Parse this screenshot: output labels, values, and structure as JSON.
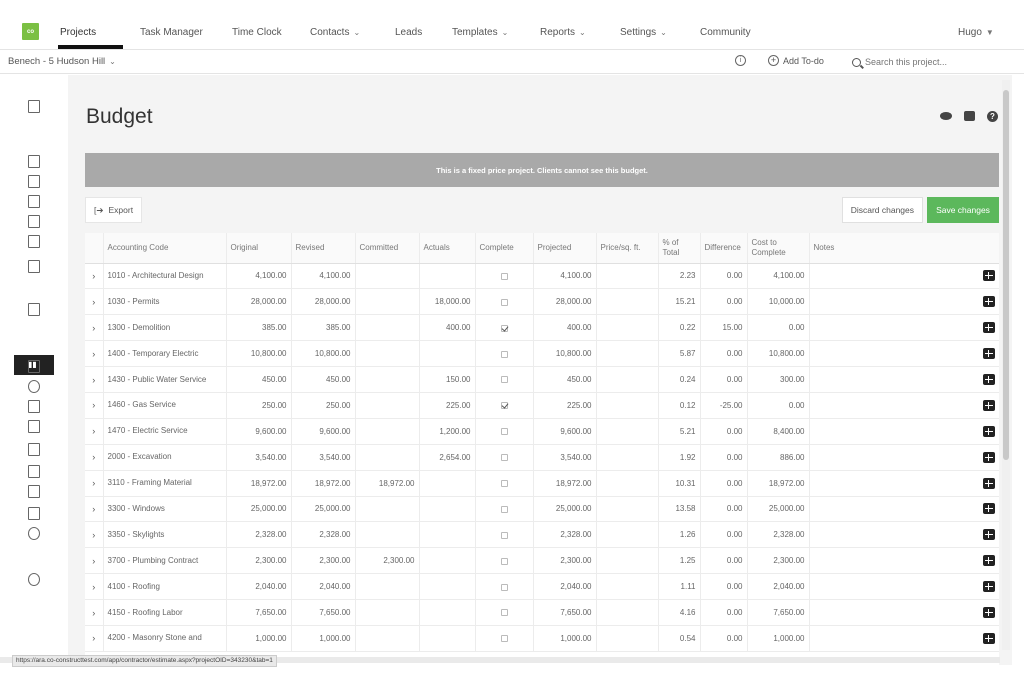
{
  "logo": "co",
  "nav": {
    "items": [
      {
        "label": "Projects",
        "caret": false
      },
      {
        "label": "Task Manager",
        "caret": false
      },
      {
        "label": "Time Clock",
        "caret": false
      },
      {
        "label": "Contacts",
        "caret": true
      },
      {
        "label": "Leads",
        "caret": false
      },
      {
        "label": "Templates",
        "caret": true
      },
      {
        "label": "Reports",
        "caret": true
      },
      {
        "label": "Settings",
        "caret": true
      },
      {
        "label": "Community",
        "caret": false
      }
    ],
    "user": "Hugo"
  },
  "subbar": {
    "project": "Benech - 5 Hudson Hill",
    "add_todo": "Add To-do",
    "search_placeholder": "Search this project..."
  },
  "page": {
    "title": "Budget",
    "banner": "This is a fixed price project. Clients cannot see this budget.",
    "export_label": "Export",
    "discard_label": "Discard changes",
    "save_label": "Save changes"
  },
  "table": {
    "headers": [
      "Accounting Code",
      "Original",
      "Revised",
      "Committed",
      "Actuals",
      "Complete",
      "Projected",
      "Price/sq. ft.",
      "% of Total",
      "Difference",
      "Cost to Complete",
      "Notes"
    ],
    "rows": [
      {
        "code": "1010 - Architectural Design",
        "original": "4,100.00",
        "revised": "4,100.00",
        "committed": "",
        "actuals": "",
        "complete": false,
        "projected": "4,100.00",
        "price_sqft": "",
        "pct_total": "2.23",
        "difference": "0.00",
        "cost_to_complete": "4,100.00"
      },
      {
        "code": "1030 - Permits",
        "original": "28,000.00",
        "revised": "28,000.00",
        "committed": "",
        "actuals": "18,000.00",
        "complete": false,
        "projected": "28,000.00",
        "price_sqft": "",
        "pct_total": "15.21",
        "difference": "0.00",
        "cost_to_complete": "10,000.00"
      },
      {
        "code": "1300 - Demolition",
        "original": "385.00",
        "revised": "385.00",
        "committed": "",
        "actuals": "400.00",
        "complete": true,
        "projected": "400.00",
        "price_sqft": "",
        "pct_total": "0.22",
        "difference": "15.00",
        "cost_to_complete": "0.00"
      },
      {
        "code": "1400 - Temporary Electric",
        "original": "10,800.00",
        "revised": "10,800.00",
        "committed": "",
        "actuals": "",
        "complete": false,
        "projected": "10,800.00",
        "price_sqft": "",
        "pct_total": "5.87",
        "difference": "0.00",
        "cost_to_complete": "10,800.00"
      },
      {
        "code": "1430 - Public Water Service",
        "original": "450.00",
        "revised": "450.00",
        "committed": "",
        "actuals": "150.00",
        "complete": false,
        "projected": "450.00",
        "price_sqft": "",
        "pct_total": "0.24",
        "difference": "0.00",
        "cost_to_complete": "300.00"
      },
      {
        "code": "1460 - Gas Service",
        "original": "250.00",
        "revised": "250.00",
        "committed": "",
        "actuals": "225.00",
        "complete": true,
        "projected": "225.00",
        "price_sqft": "",
        "pct_total": "0.12",
        "difference": "-25.00",
        "cost_to_complete": "0.00"
      },
      {
        "code": "1470 - Electric Service",
        "original": "9,600.00",
        "revised": "9,600.00",
        "committed": "",
        "actuals": "1,200.00",
        "complete": false,
        "projected": "9,600.00",
        "price_sqft": "",
        "pct_total": "5.21",
        "difference": "0.00",
        "cost_to_complete": "8,400.00"
      },
      {
        "code": "2000 - Excavation",
        "original": "3,540.00",
        "revised": "3,540.00",
        "committed": "",
        "actuals": "2,654.00",
        "complete": false,
        "projected": "3,540.00",
        "price_sqft": "",
        "pct_total": "1.92",
        "difference": "0.00",
        "cost_to_complete": "886.00"
      },
      {
        "code": "3110 - Framing Material",
        "original": "18,972.00",
        "revised": "18,972.00",
        "committed": "18,972.00",
        "actuals": "",
        "complete": false,
        "projected": "18,972.00",
        "price_sqft": "",
        "pct_total": "10.31",
        "difference": "0.00",
        "cost_to_complete": "18,972.00"
      },
      {
        "code": "3300 - Windows",
        "original": "25,000.00",
        "revised": "25,000.00",
        "committed": "",
        "actuals": "",
        "complete": false,
        "projected": "25,000.00",
        "price_sqft": "",
        "pct_total": "13.58",
        "difference": "0.00",
        "cost_to_complete": "25,000.00"
      },
      {
        "code": "3350 - Skylights",
        "original": "2,328.00",
        "revised": "2,328.00",
        "committed": "",
        "actuals": "",
        "complete": false,
        "projected": "2,328.00",
        "price_sqft": "",
        "pct_total": "1.26",
        "difference": "0.00",
        "cost_to_complete": "2,328.00"
      },
      {
        "code": "3700 - Plumbing Contract",
        "original": "2,300.00",
        "revised": "2,300.00",
        "committed": "2,300.00",
        "actuals": "",
        "complete": false,
        "projected": "2,300.00",
        "price_sqft": "",
        "pct_total": "1.25",
        "difference": "0.00",
        "cost_to_complete": "2,300.00"
      },
      {
        "code": "4100 - Roofing",
        "original": "2,040.00",
        "revised": "2,040.00",
        "committed": "",
        "actuals": "",
        "complete": false,
        "projected": "2,040.00",
        "price_sqft": "",
        "pct_total": "1.11",
        "difference": "0.00",
        "cost_to_complete": "2,040.00"
      },
      {
        "code": "4150 - Roofing Labor",
        "original": "7,650.00",
        "revised": "7,650.00",
        "committed": "",
        "actuals": "",
        "complete": false,
        "projected": "7,650.00",
        "price_sqft": "",
        "pct_total": "4.16",
        "difference": "0.00",
        "cost_to_complete": "7,650.00"
      },
      {
        "code": "4200 - Masonry Stone and",
        "original": "1,000.00",
        "revised": "1,000.00",
        "committed": "",
        "actuals": "",
        "complete": false,
        "projected": "1,000.00",
        "price_sqft": "",
        "pct_total": "0.54",
        "difference": "0.00",
        "cost_to_complete": "1,000.00"
      }
    ]
  },
  "status_url": "https://ara.co-constructtest.com/app/contractor/estimate.aspx?projectOID=343230&tab=1"
}
